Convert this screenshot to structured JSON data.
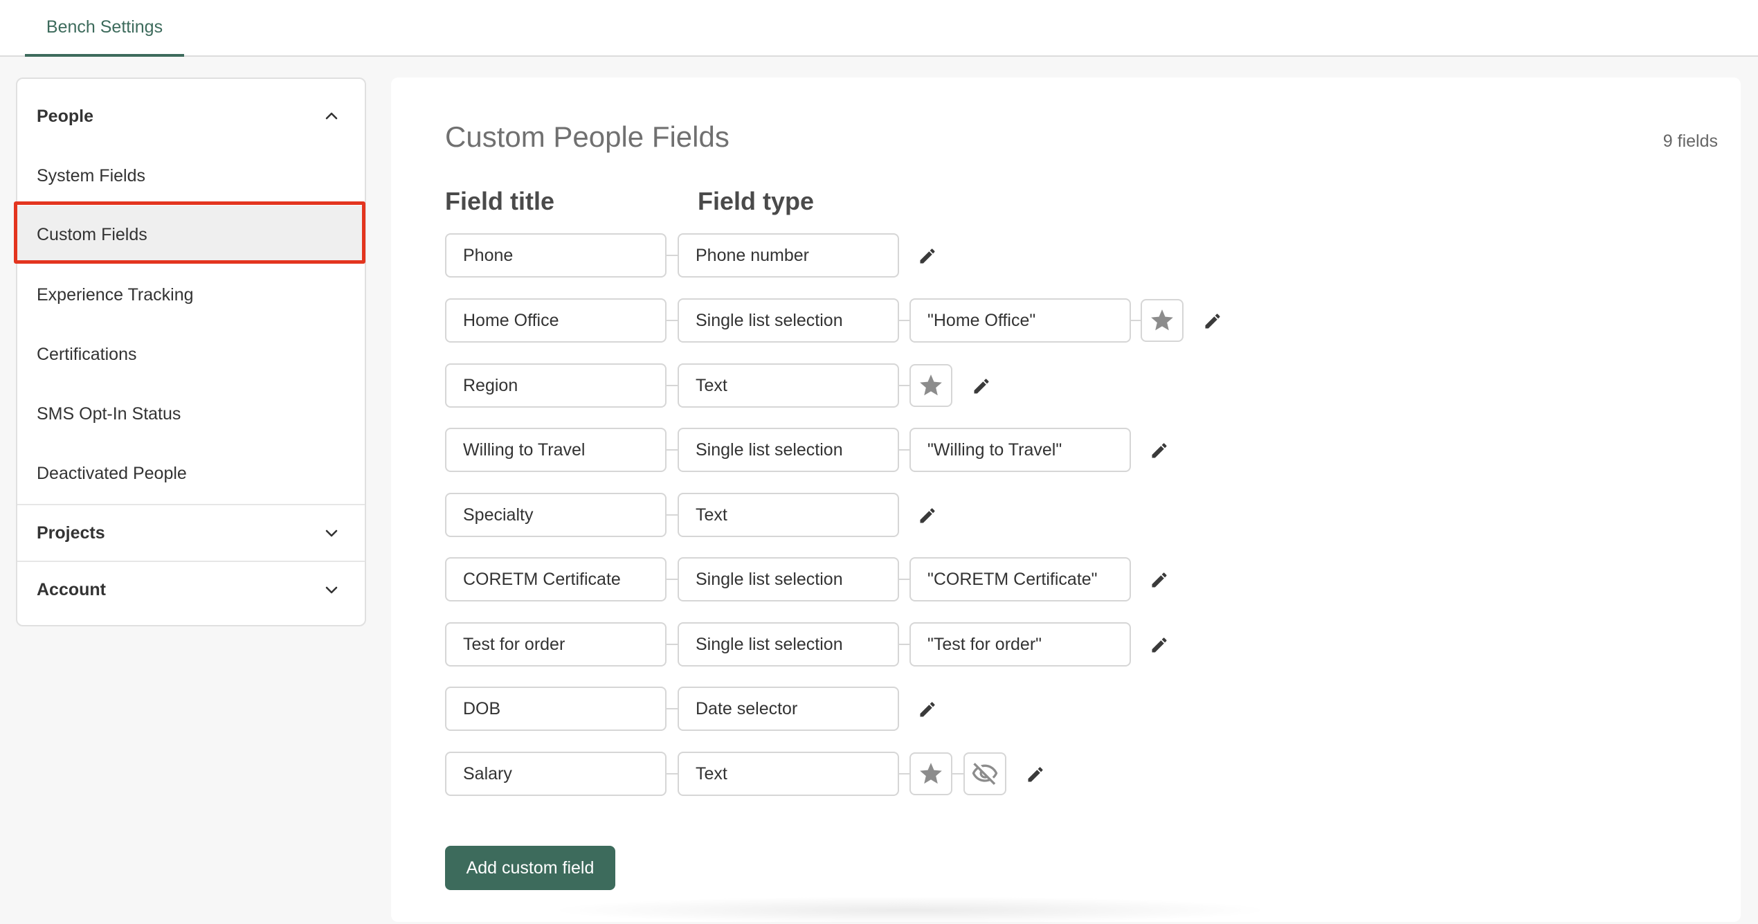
{
  "header": {
    "tab_label": "Bench Settings"
  },
  "sidebar": {
    "people_label": "People",
    "people_items": [
      {
        "label": "System Fields"
      },
      {
        "label": "Custom Fields"
      },
      {
        "label": "Experience Tracking"
      },
      {
        "label": "Certifications"
      },
      {
        "label": "SMS Opt-In Status"
      },
      {
        "label": "Deactivated People"
      }
    ],
    "projects_label": "Projects",
    "account_label": "Account",
    "active_item": "Custom Fields"
  },
  "main": {
    "title": "Custom People Fields",
    "field_count": "9 fields",
    "col_field_title": "Field title",
    "col_field_type": "Field type",
    "rows": [
      {
        "title": "Phone",
        "type": "Phone number"
      },
      {
        "title": "Home Office",
        "type": "Single list selection",
        "list": "\"Home Office\"",
        "starred": true
      },
      {
        "title": "Region",
        "type": "Text",
        "starred": true
      },
      {
        "title": "Willing to Travel",
        "type": "Single list selection",
        "list": "\"Willing to Travel\""
      },
      {
        "title": "Specialty",
        "type": "Text"
      },
      {
        "title": "CORETM Certificate",
        "type": "Single list selection",
        "list": "\"CORETM Certificate\""
      },
      {
        "title": "Test for order",
        "type": "Single list selection",
        "list": "\"Test for order\""
      },
      {
        "title": "DOB",
        "type": "Date selector"
      },
      {
        "title": "Salary",
        "type": "Text",
        "starred": true,
        "hidden": true
      }
    ],
    "add_button_label": "Add custom field"
  },
  "colors": {
    "accent": "#3d6b5c",
    "highlight": "#e3351f"
  },
  "icons": {
    "star": "star-icon",
    "edit": "pencil-icon",
    "hidden": "eye-off-icon",
    "chevron_up": "chevron-up-icon",
    "chevron_down": "chevron-down-icon"
  }
}
